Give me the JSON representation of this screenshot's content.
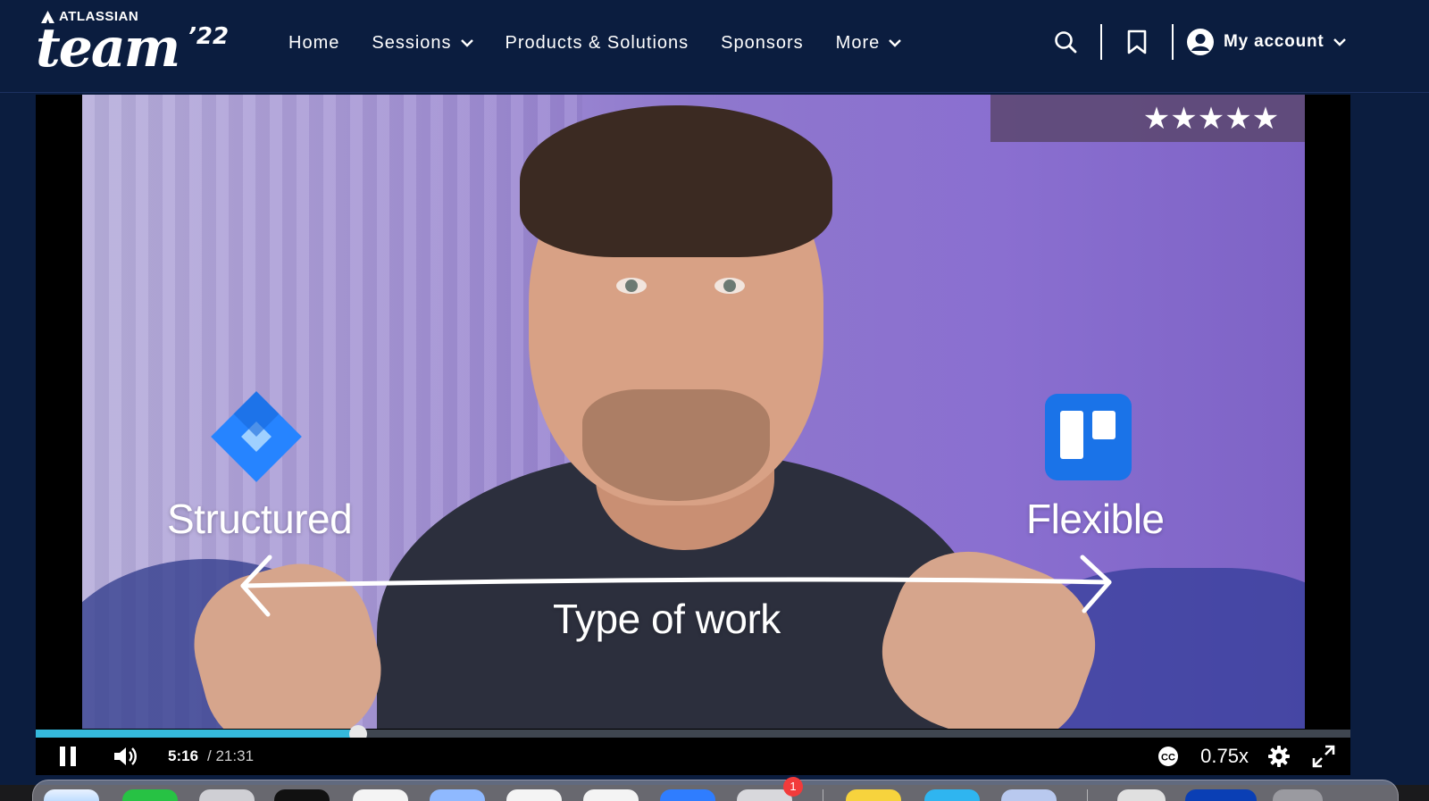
{
  "header": {
    "brand": "ATLASSIAN",
    "event_name": "team",
    "event_year": "’22",
    "nav": [
      {
        "label": "Home",
        "has_dropdown": false
      },
      {
        "label": "Sessions",
        "has_dropdown": true
      },
      {
        "label": "Products & Solutions",
        "has_dropdown": false
      },
      {
        "label": "Sponsors",
        "has_dropdown": false
      },
      {
        "label": "More",
        "has_dropdown": true
      }
    ],
    "icons": [
      "search-icon",
      "bookmark-icon"
    ],
    "account_label": "My account"
  },
  "video": {
    "rating_stars": "★★★★★",
    "overlay": {
      "left_label": "Structured",
      "right_label": "Flexible",
      "axis_label": "Type of work"
    },
    "logos": [
      "jira-logo",
      "trello-logo"
    ],
    "progress_fraction": 0.245,
    "time_current": "5:16",
    "time_total": "/ 21:31",
    "captions_label": "CC",
    "speed": "0.75x",
    "colors": {
      "progress": "#35b9dc",
      "header_bg": "#0b1d3f",
      "jira_blue": "#2684ff",
      "trello_blue": "#1a73e8"
    }
  },
  "dock": {
    "badge_count": "1"
  }
}
